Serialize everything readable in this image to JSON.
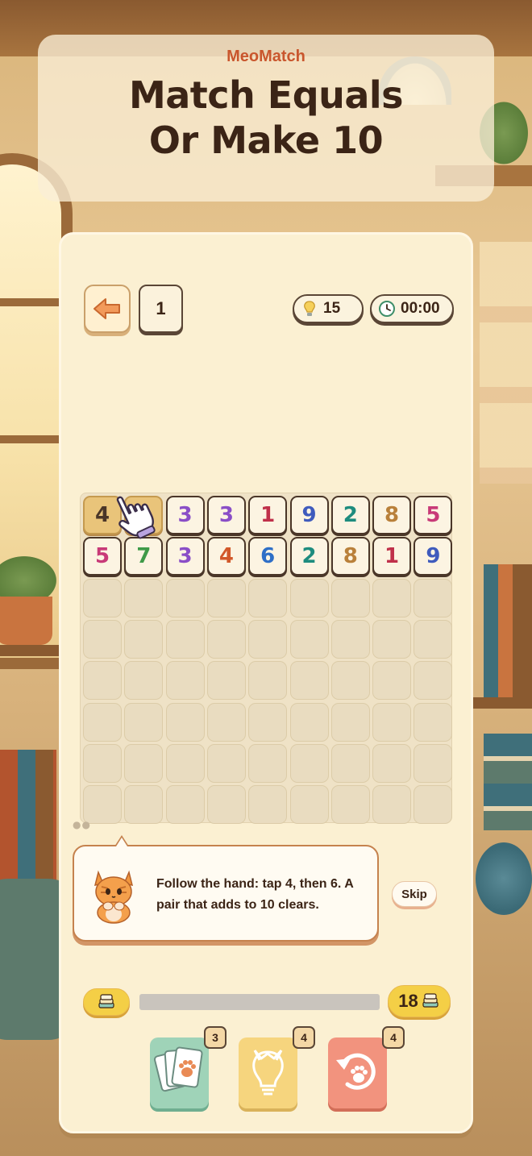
{
  "header": {
    "brand": "MeoMatch",
    "headline_line1": "Match Equals",
    "headline_line2": "Or Make 10"
  },
  "topbar": {
    "level": "1",
    "hints": "15",
    "timer": "00:00"
  },
  "board": {
    "columns": 9,
    "rows": 8,
    "filled_rows": [
      [
        "4",
        "",
        "3",
        "3",
        "1",
        "9",
        "2",
        "8",
        "5"
      ],
      [
        "5",
        "7",
        "3",
        "4",
        "6",
        "2",
        "8",
        "1",
        "9"
      ]
    ],
    "selected_cells": [
      "0-0",
      "0-1"
    ]
  },
  "colors": {
    "1": "#c0304a",
    "2": "#1e8c7e",
    "3": "#8a4ec7",
    "4": "#d2582a",
    "5": "#c83a78",
    "6": "#2e6fc7",
    "7": "#3f9a48",
    "8": "#b9803a",
    "9": "#3f5bbd",
    "accent": "#c9562d",
    "panel": "#fbf0d2"
  },
  "tutorial": {
    "text": "Follow the hand: tap 4, then 6. A pair that adds to 10 clears.",
    "skip_label": "Skip"
  },
  "progress": {
    "value": 0,
    "target": "18"
  },
  "powerups": [
    {
      "name": "cards",
      "count": "3",
      "icon": "paw-cards-icon"
    },
    {
      "name": "hint",
      "count": "4",
      "icon": "cat-bulb-icon"
    },
    {
      "name": "undo",
      "count": "4",
      "icon": "undo-paw-icon"
    }
  ]
}
